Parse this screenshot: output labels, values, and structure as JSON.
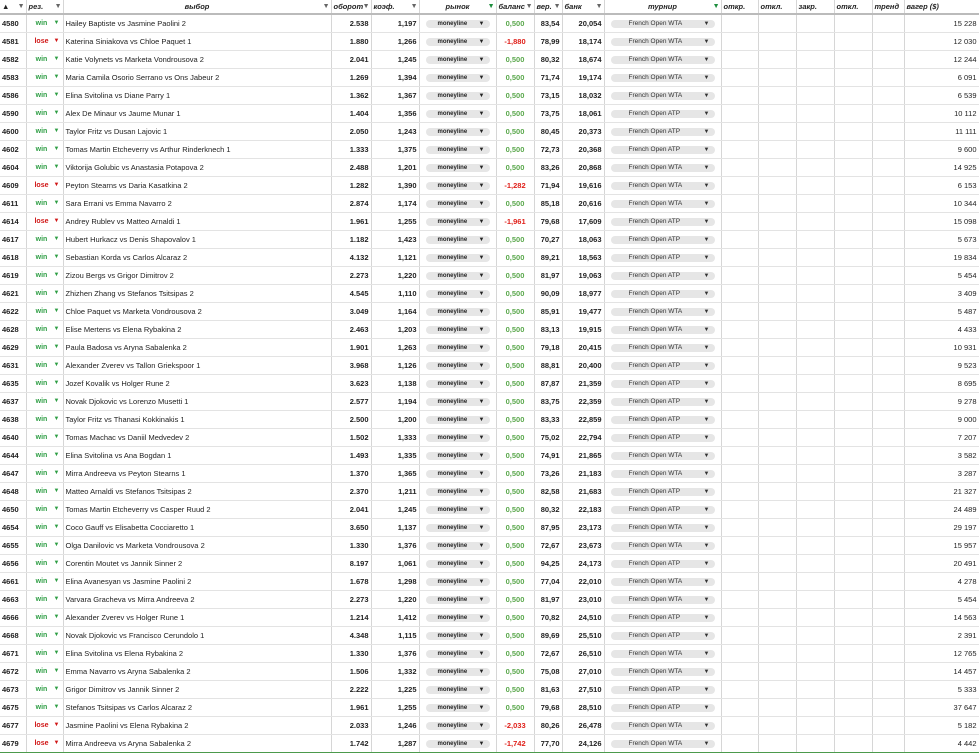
{
  "headers": {
    "id": "▲",
    "res": "рез.",
    "pick": "выбор",
    "turnover": "оборот",
    "coef": "коэф.",
    "market": "рынок",
    "balance": "баланс",
    "prob": "вер.",
    "bank": "банк",
    "tournament": "турнир",
    "open1": "откр.",
    "dev1": "откл.",
    "close": "закр.",
    "dev2": "откл.",
    "trend": "тренд",
    "volume": "вагер ($)"
  },
  "filter_icon": "▼",
  "caret": "▼",
  "rows": [
    {
      "id": "4580",
      "res": "win",
      "pick": "Hailey Baptiste vs Jasmine Paolini 2",
      "turnover": "2.538",
      "coef": "1,197",
      "market": "moneyline",
      "balance": "0,500",
      "prob": "83,54",
      "bank": "20,054",
      "tour": "French Open WTA",
      "volume": "15 228"
    },
    {
      "id": "4581",
      "res": "lose",
      "pick": "Katerina Siniakova vs Chloe Paquet 1",
      "turnover": "1.880",
      "coef": "1,266",
      "market": "moneyline",
      "balance": "-1,880",
      "prob": "78,99",
      "bank": "18,174",
      "tour": "French Open WTA",
      "volume": "12 030"
    },
    {
      "id": "4582",
      "res": "win",
      "pick": "Katie Volynets vs Marketa Vondrousova 2",
      "turnover": "2.041",
      "coef": "1,245",
      "market": "moneyline",
      "balance": "0,500",
      "prob": "80,32",
      "bank": "18,674",
      "tour": "French Open WTA",
      "volume": "12 244"
    },
    {
      "id": "4583",
      "res": "win",
      "pick": "Maria Camila Osorio Serrano vs Ons Jabeur 2",
      "turnover": "1.269",
      "coef": "1,394",
      "market": "moneyline",
      "balance": "0,500",
      "prob": "71,74",
      "bank": "19,174",
      "tour": "French Open WTA",
      "volume": "6 091"
    },
    {
      "id": "4586",
      "res": "win",
      "pick": "Elina Svitolina vs Diane Parry 1",
      "turnover": "1.362",
      "coef": "1,367",
      "market": "moneyline",
      "balance": "0,500",
      "prob": "73,15",
      "bank": "18,032",
      "tour": "French Open WTA",
      "volume": "6 539"
    },
    {
      "id": "4590",
      "res": "win",
      "pick": "Alex De Minaur vs Jaume Munar 1",
      "turnover": "1.404",
      "coef": "1,356",
      "market": "moneyline",
      "balance": "0,500",
      "prob": "73,75",
      "bank": "18,061",
      "tour": "French Open ATP",
      "volume": "10 112"
    },
    {
      "id": "4600",
      "res": "win",
      "pick": "Taylor Fritz vs Dusan Lajovic 1",
      "turnover": "2.050",
      "coef": "1,243",
      "market": "moneyline",
      "balance": "0,500",
      "prob": "80,45",
      "bank": "20,373",
      "tour": "French Open ATP",
      "volume": "11 111"
    },
    {
      "id": "4602",
      "res": "win",
      "pick": "Tomas Martin Etcheverry vs Arthur Rinderknech 1",
      "turnover": "1.333",
      "coef": "1,375",
      "market": "moneyline",
      "balance": "0,500",
      "prob": "72,73",
      "bank": "20,368",
      "tour": "French Open ATP",
      "volume": "9 600"
    },
    {
      "id": "4604",
      "res": "win",
      "pick": "Viktorija Golubic vs Anastasia Potapova 2",
      "turnover": "2.488",
      "coef": "1,201",
      "market": "moneyline",
      "balance": "0,500",
      "prob": "83,26",
      "bank": "20,868",
      "tour": "French Open WTA",
      "volume": "14 925"
    },
    {
      "id": "4609",
      "res": "lose",
      "pick": "Peyton Stearns vs Daria Kasatkina 2",
      "turnover": "1.282",
      "coef": "1,390",
      "market": "moneyline",
      "balance": "-1,282",
      "prob": "71,94",
      "bank": "19,616",
      "tour": "French Open WTA",
      "volume": "6 153"
    },
    {
      "id": "4611",
      "res": "win",
      "pick": "Sara Errani vs Emma Navarro 2",
      "turnover": "2.874",
      "coef": "1,174",
      "market": "moneyline",
      "balance": "0,500",
      "prob": "85,18",
      "bank": "20,616",
      "tour": "French Open WTA",
      "volume": "10 344"
    },
    {
      "id": "4614",
      "res": "lose",
      "pick": "Andrey Rublev vs Matteo Arnaldi 1",
      "turnover": "1.961",
      "coef": "1,255",
      "market": "moneyline",
      "balance": "-1,961",
      "prob": "79,68",
      "bank": "17,609",
      "tour": "French Open ATP",
      "volume": "15 098"
    },
    {
      "id": "4617",
      "res": "win",
      "pick": "Hubert Hurkacz vs Denis Shapovalov 1",
      "turnover": "1.182",
      "coef": "1,423",
      "market": "moneyline",
      "balance": "0,500",
      "prob": "70,27",
      "bank": "18,063",
      "tour": "French Open ATP",
      "volume": "5 673"
    },
    {
      "id": "4618",
      "res": "win",
      "pick": "Sebastian Korda vs Carlos Alcaraz 2",
      "turnover": "4.132",
      "coef": "1,121",
      "market": "moneyline",
      "balance": "0,500",
      "prob": "89,21",
      "bank": "18,563",
      "tour": "French Open ATP",
      "volume": "19 834"
    },
    {
      "id": "4619",
      "res": "win",
      "pick": "Zizou Bergs vs Grigor Dimitrov 2",
      "turnover": "2.273",
      "coef": "1,220",
      "market": "moneyline",
      "balance": "0,500",
      "prob": "81,97",
      "bank": "19,063",
      "tour": "French Open ATP",
      "volume": "5 454"
    },
    {
      "id": "4621",
      "res": "win",
      "pick": "Zhizhen Zhang vs Stefanos Tsitsipas 2",
      "turnover": "4.545",
      "coef": "1,110",
      "market": "moneyline",
      "balance": "0,500",
      "prob": "90,09",
      "bank": "18,977",
      "tour": "French Open ATP",
      "volume": "3 409"
    },
    {
      "id": "4622",
      "res": "win",
      "pick": "Chloe Paquet vs Marketa Vondrousova 2",
      "turnover": "3.049",
      "coef": "1,164",
      "market": "moneyline",
      "balance": "0,500",
      "prob": "85,91",
      "bank": "19,477",
      "tour": "French Open WTA",
      "volume": "5 487"
    },
    {
      "id": "4628",
      "res": "win",
      "pick": "Elise Mertens vs Elena Rybakina 2",
      "turnover": "2.463",
      "coef": "1,203",
      "market": "moneyline",
      "balance": "0,500",
      "prob": "83,13",
      "bank": "19,915",
      "tour": "French Open WTA",
      "volume": "4 433"
    },
    {
      "id": "4629",
      "res": "win",
      "pick": "Paula Badosa vs Aryna Sabalenka 2",
      "turnover": "1.901",
      "coef": "1,263",
      "market": "moneyline",
      "balance": "0,500",
      "prob": "79,18",
      "bank": "20,415",
      "tour": "French Open WTA",
      "volume": "10 931"
    },
    {
      "id": "4631",
      "res": "win",
      "pick": "Alexander Zverev vs Tallon Griekspoor 1",
      "turnover": "3.968",
      "coef": "1,126",
      "market": "moneyline",
      "balance": "0,500",
      "prob": "88,81",
      "bank": "20,400",
      "tour": "French Open ATP",
      "volume": "9 523"
    },
    {
      "id": "4635",
      "res": "win",
      "pick": "Jozef Kovalik vs Holger Rune 2",
      "turnover": "3.623",
      "coef": "1,138",
      "market": "moneyline",
      "balance": "0,500",
      "prob": "87,87",
      "bank": "21,359",
      "tour": "French Open ATP",
      "volume": "8 695"
    },
    {
      "id": "4637",
      "res": "win",
      "pick": "Novak Djokovic vs Lorenzo Musetti 1",
      "turnover": "2.577",
      "coef": "1,194",
      "market": "moneyline",
      "balance": "0,500",
      "prob": "83,75",
      "bank": "22,359",
      "tour": "French Open ATP",
      "volume": "9 278"
    },
    {
      "id": "4638",
      "res": "win",
      "pick": "Taylor Fritz vs Thanasi Kokkinakis 1",
      "turnover": "2.500",
      "coef": "1,200",
      "market": "moneyline",
      "balance": "0,500",
      "prob": "83,33",
      "bank": "22,859",
      "tour": "French Open ATP",
      "volume": "9 000"
    },
    {
      "id": "4640",
      "res": "win",
      "pick": "Tomas Machac vs Daniil Medvedev 2",
      "turnover": "1.502",
      "coef": "1,333",
      "market": "moneyline",
      "balance": "0,500",
      "prob": "75,02",
      "bank": "22,794",
      "tour": "French Open ATP",
      "volume": "7 207"
    },
    {
      "id": "4644",
      "res": "win",
      "pick": "Elina Svitolina vs Ana Bogdan 1",
      "turnover": "1.493",
      "coef": "1,335",
      "market": "moneyline",
      "balance": "0,500",
      "prob": "74,91",
      "bank": "21,865",
      "tour": "French Open WTA",
      "volume": "3 582"
    },
    {
      "id": "4647",
      "res": "win",
      "pick": "Mirra Andreeva vs Peyton Stearns 1",
      "turnover": "1.370",
      "coef": "1,365",
      "market": "moneyline",
      "balance": "0,500",
      "prob": "73,26",
      "bank": "21,183",
      "tour": "French Open WTA",
      "volume": "3 287"
    },
    {
      "id": "4648",
      "res": "win",
      "pick": "Matteo Arnaldi vs Stefanos Tsitsipas 2",
      "turnover": "2.370",
      "coef": "1,211",
      "market": "moneyline",
      "balance": "0,500",
      "prob": "82,58",
      "bank": "21,683",
      "tour": "French Open ATP",
      "volume": "21 327"
    },
    {
      "id": "4650",
      "res": "win",
      "pick": "Tomas Martin Etcheverry vs Casper Ruud 2",
      "turnover": "2.041",
      "coef": "1,245",
      "market": "moneyline",
      "balance": "0,500",
      "prob": "80,32",
      "bank": "22,183",
      "tour": "French Open ATP",
      "volume": "24 489"
    },
    {
      "id": "4654",
      "res": "win",
      "pick": "Coco Gauff vs Elisabetta Cocciaretto 1",
      "turnover": "3.650",
      "coef": "1,137",
      "market": "moneyline",
      "balance": "0,500",
      "prob": "87,95",
      "bank": "23,173",
      "tour": "French Open WTA",
      "volume": "29 197"
    },
    {
      "id": "4655",
      "res": "win",
      "pick": "Olga Danilovic vs Marketa Vondrousova 2",
      "turnover": "1.330",
      "coef": "1,376",
      "market": "moneyline",
      "balance": "0,500",
      "prob": "72,67",
      "bank": "23,673",
      "tour": "French Open WTA",
      "volume": "15 957"
    },
    {
      "id": "4656",
      "res": "win",
      "pick": "Corentin Moutet vs Jannik Sinner 2",
      "turnover": "8.197",
      "coef": "1,061",
      "market": "moneyline",
      "balance": "0,500",
      "prob": "94,25",
      "bank": "24,173",
      "tour": "French Open ATP",
      "volume": "20 491"
    },
    {
      "id": "4661",
      "res": "win",
      "pick": "Elina Avanesyan vs Jasmine Paolini 2",
      "turnover": "1.678",
      "coef": "1,298",
      "market": "moneyline",
      "balance": "0,500",
      "prob": "77,04",
      "bank": "22,010",
      "tour": "French Open WTA",
      "volume": "4 278"
    },
    {
      "id": "4663",
      "res": "win",
      "pick": "Varvara Gracheva vs Mirra Andreeva 2",
      "turnover": "2.273",
      "coef": "1,220",
      "market": "moneyline",
      "balance": "0,500",
      "prob": "81,97",
      "bank": "23,010",
      "tour": "French Open WTA",
      "volume": "5 454"
    },
    {
      "id": "4666",
      "res": "win",
      "pick": "Alexander Zverev vs Holger Rune 1",
      "turnover": "1.214",
      "coef": "1,412",
      "market": "moneyline",
      "balance": "0,500",
      "prob": "70,82",
      "bank": "24,510",
      "tour": "French Open ATP",
      "volume": "14 563"
    },
    {
      "id": "4668",
      "res": "win",
      "pick": "Novak Djokovic vs Francisco Cerundolo 1",
      "turnover": "4.348",
      "coef": "1,115",
      "market": "moneyline",
      "balance": "0,500",
      "prob": "89,69",
      "bank": "25,510",
      "tour": "French Open ATP",
      "volume": "2 391"
    },
    {
      "id": "4671",
      "res": "win",
      "pick": "Elina Svitolina vs Elena Rybakina 2",
      "turnover": "1.330",
      "coef": "1,376",
      "market": "moneyline",
      "balance": "0,500",
      "prob": "72,67",
      "bank": "26,510",
      "tour": "French Open WTA",
      "volume": "12 765"
    },
    {
      "id": "4672",
      "res": "win",
      "pick": "Emma Navarro vs Aryna Sabalenka 2",
      "turnover": "1.506",
      "coef": "1,332",
      "market": "moneyline",
      "balance": "0,500",
      "prob": "75,08",
      "bank": "27,010",
      "tour": "French Open WTA",
      "volume": "14 457"
    },
    {
      "id": "4673",
      "res": "win",
      "pick": "Grigor Dimitrov vs Jannik Sinner 2",
      "turnover": "2.222",
      "coef": "1,225",
      "market": "moneyline",
      "balance": "0,500",
      "prob": "81,63",
      "bank": "27,510",
      "tour": "French Open ATP",
      "volume": "5 333"
    },
    {
      "id": "4675",
      "res": "win",
      "pick": "Stefanos Tsitsipas vs Carlos Alcaraz 2",
      "turnover": "1.961",
      "coef": "1,255",
      "market": "moneyline",
      "balance": "0,500",
      "prob": "79,68",
      "bank": "28,510",
      "tour": "French Open ATP",
      "volume": "37 647"
    },
    {
      "id": "4677",
      "res": "lose",
      "pick": "Jasmine Paolini vs Elena Rybakina 2",
      "turnover": "2.033",
      "coef": "1,246",
      "market": "moneyline",
      "balance": "-2,033",
      "prob": "80,26",
      "bank": "26,478",
      "tour": "French Open WTA",
      "volume": "5 182"
    },
    {
      "id": "4679",
      "res": "lose",
      "pick": "Mirra Andreeva vs Aryna Sabalenka 2",
      "turnover": "1.742",
      "coef": "1,287",
      "market": "moneyline",
      "balance": "-1,742",
      "prob": "77,70",
      "bank": "24,126",
      "tour": "French Open WTA",
      "volume": "4 442"
    }
  ],
  "colors": {
    "win": "#2e9e44",
    "lose": "#d01616",
    "balance_pos": "#5aa84c",
    "balance_neg": "#e0201a",
    "border_accent": "#4c9a4c"
  }
}
